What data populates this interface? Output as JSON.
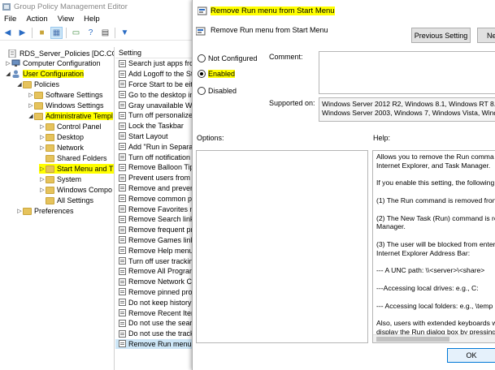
{
  "window": {
    "title": "Group Policy Management Editor",
    "menu": [
      "File",
      "Action",
      "View",
      "Help"
    ]
  },
  "tree": {
    "root": "RDS_Server_Policies [DC.CONTO",
    "computer_configuration": "Computer Configuration",
    "user_configuration": "User Configuration",
    "policies": "Policies",
    "software_settings": "Software Settings",
    "windows_settings": "Windows Settings",
    "administrative_templates": "Administrative Templ",
    "control_panel": "Control Panel",
    "desktop": "Desktop",
    "network": "Network",
    "shared_folders": "Shared Folders",
    "start_menu": "Start Menu and T",
    "system": "System",
    "windows_components": "Windows Compo",
    "all_settings": "All Settings",
    "preferences": "Preferences"
  },
  "settings_list": {
    "header": "Setting",
    "items": [
      "Search just apps fror",
      "Add Logoff to the St",
      "Force Start to be eith",
      "Go to the desktop in",
      "Gray unavailable Wir",
      "Turn off personalized",
      "Lock the Taskbar",
      "Start Layout",
      "Add \"Run in Separat",
      "Turn off notification",
      "Remove Balloon Tip",
      "Prevent users from c",
      "Remove and prevent",
      "Remove common pr",
      "Remove Favorites m",
      "Remove Search link",
      "Remove frequent pr",
      "Remove Games link",
      "Remove Help menu",
      "Turn off user trackin",
      "Remove All Program",
      "Remove Network Co",
      "Remove pinned prog",
      "Do not keep history",
      "Remove Recent Item",
      "Do not use the searc",
      "Do not use the track",
      "Remove Run menu"
    ]
  },
  "dialog": {
    "title": "Remove Run menu from Start Menu",
    "policy_name": "Remove Run menu from Start Menu",
    "previous_setting": "Previous Setting",
    "next_setting": "Ne",
    "radio_not_configured": "Not Configured",
    "radio_enabled": "Enabled",
    "radio_disabled": "Disabled",
    "selected_option": "Enabled",
    "comment_label": "Comment:",
    "supported_label": "Supported on:",
    "supported_lines": [
      "Windows Server 2012 R2, Windows 8.1, Windows RT 8.1,",
      "Windows Server 2003, Windows 7, Windows Vista, Windo"
    ],
    "options_label": "Options:",
    "help_label": "Help:",
    "help_paragraphs": [
      [
        "Allows you to remove the Run comma",
        "Internet Explorer, and Task Manager."
      ],
      [
        "If you enable this setting, the following"
      ],
      [
        "(1) The Run command is removed fron"
      ],
      [
        "(2) The New Task (Run) command is re",
        "Manager."
      ],
      [
        "(3) The user will be blocked from enter",
        "Internet Explorer Address Bar:"
      ],
      [
        "--- A UNC path: \\\\<server>\\<share>"
      ],
      [
        "---Accessing local drives:  e.g., C:"
      ],
      [
        "--- Accessing local folders: e.g., \\temp"
      ],
      [
        "Also, users with extended keyboards w",
        "display the Run dialog box by pressing"
      ]
    ],
    "ok_label": "OK"
  },
  "colors": {
    "highlight": "#ffff00",
    "folder": "#e6c35c",
    "selection": "#cde6f7"
  }
}
